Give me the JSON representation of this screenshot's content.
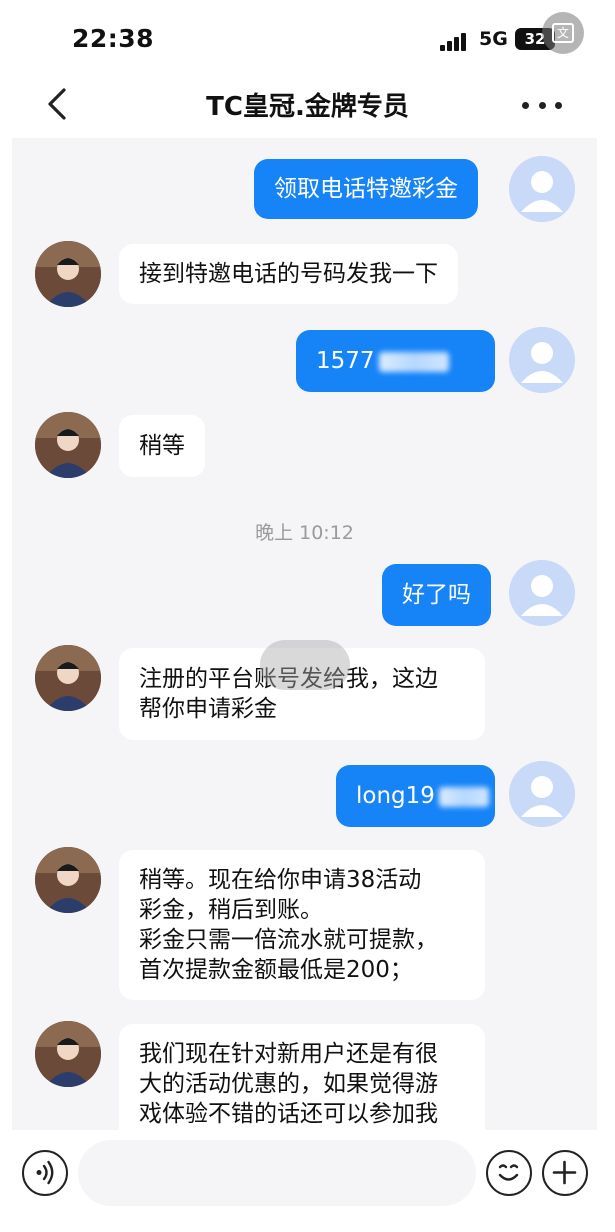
{
  "status_bar": {
    "time": "22:38",
    "network": "5G",
    "battery": "32",
    "translate_label": "文"
  },
  "header": {
    "title": "TC皇冠.金牌专员",
    "back_icon": "chevron-left-icon",
    "more_icon": "more-dots-icon"
  },
  "messages": [
    {
      "from": "me",
      "lines": [
        "领取电话特邀彩金"
      ]
    },
    {
      "from": "agent",
      "lines": [
        "接到特邀电话的号码发我一下"
      ]
    },
    {
      "from": "me",
      "text_visible": "1577",
      "redacted": true
    },
    {
      "from": "agent",
      "lines": [
        "稍等"
      ]
    },
    {
      "from": "me",
      "lines": [
        "好了吗"
      ]
    },
    {
      "from": "agent",
      "lines": [
        "注册的平台账号发给我，这边",
        "帮你申请彩金"
      ]
    },
    {
      "from": "me",
      "text_visible": "long19",
      "redacted": true
    },
    {
      "from": "agent",
      "lines": [
        "稍等。现在给你申请38活动",
        "彩金，稍后到账。",
        "彩金只需一倍流水就可提款，",
        "首次提款金额最低是200；"
      ]
    },
    {
      "from": "agent",
      "lines": [
        "我们现在针对新用户还是有很",
        "大的活动优惠的，如果觉得游",
        "戏体验不错的话还可以参加我"
      ]
    }
  ],
  "timestamp": "晚上 10:12",
  "input_bar": {
    "placeholder": "",
    "voice_icon": "voice-icon",
    "emoji_icon": "emoji-icon",
    "add_icon": "plus-icon"
  },
  "colors": {
    "outgoing_bubble": "#1683f7",
    "incoming_bubble": "#ffffff",
    "chat_background": "#f5f5f7"
  }
}
